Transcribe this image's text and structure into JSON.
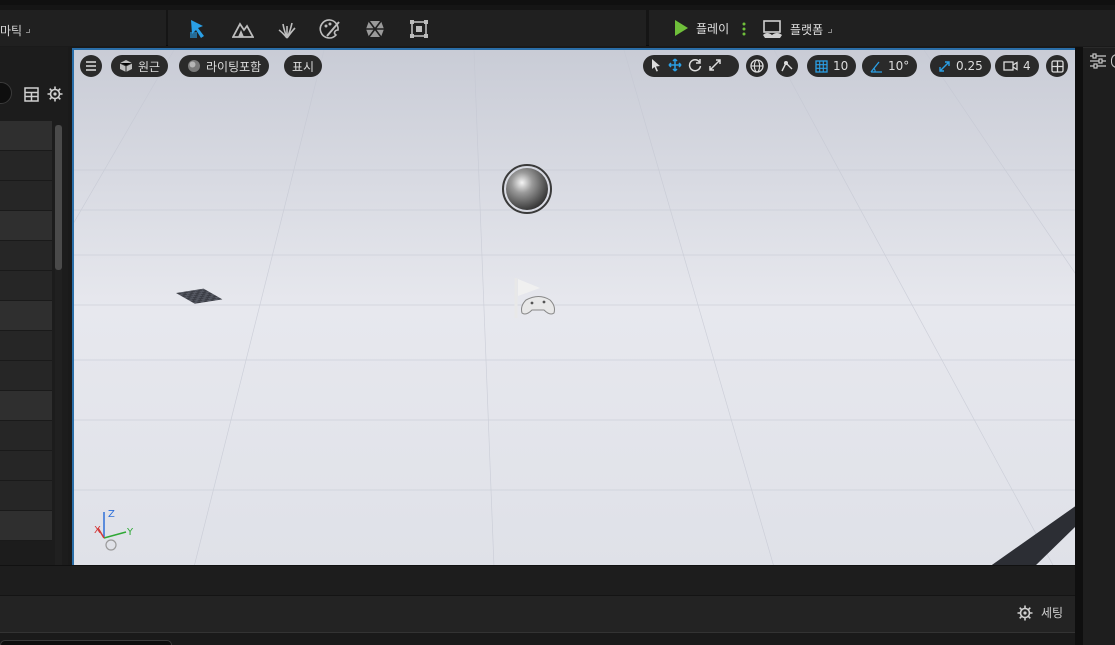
{
  "toolbar": {
    "left_menu_label": "마틱",
    "mode_icons": [
      "select-mode-icon",
      "landscape-mode-icon",
      "foliage-mode-icon",
      "mesh-paint-mode-icon",
      "fracture-mode-icon",
      "modeling-mode-icon"
    ],
    "play_label": "플레이",
    "platform_label": "플랫폼"
  },
  "viewport": {
    "perspective_label": "원근",
    "lighting_label": "라이팅포함",
    "show_label": "표시",
    "grid_snap_value": "10",
    "rotation_snap_value": "10°",
    "scale_snap_value": "0.25",
    "camera_speed_value": "4",
    "axis_labels": {
      "x": "X",
      "y": "Y",
      "z": "Z"
    }
  },
  "bottom": {
    "settings_label": "세팅"
  },
  "colors": {
    "accent_blue": "#2a9fe5",
    "play_green": "#6fbf3a",
    "toolbar_bg": "#202020",
    "viewport_sky": "#d7d9e2"
  }
}
